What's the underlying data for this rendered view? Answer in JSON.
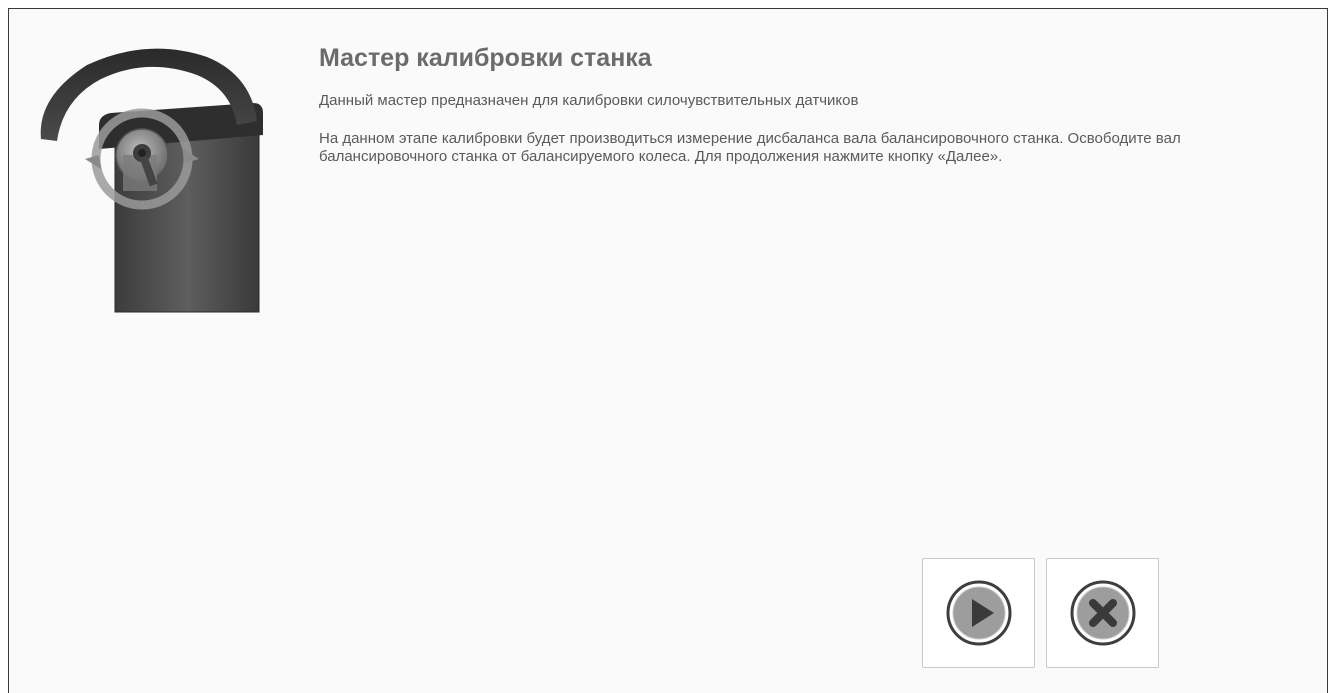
{
  "wizard": {
    "title": "Мастер калибровки станка",
    "description": "Данный мастер предназначен для калибровки силочувствительных датчиков",
    "instruction": "На данном этапе калибровки будет производиться измерение дисбаланса вала балансировочного станка. Освободите вал балансировочного станка от балансируемого колеса. Для продолжения нажмите кнопку «Далее»."
  },
  "illustration": {
    "icon": "wheel-balancer-rotation-icon"
  },
  "buttons": {
    "next_icon": "play-icon",
    "cancel_icon": "close-icon"
  }
}
